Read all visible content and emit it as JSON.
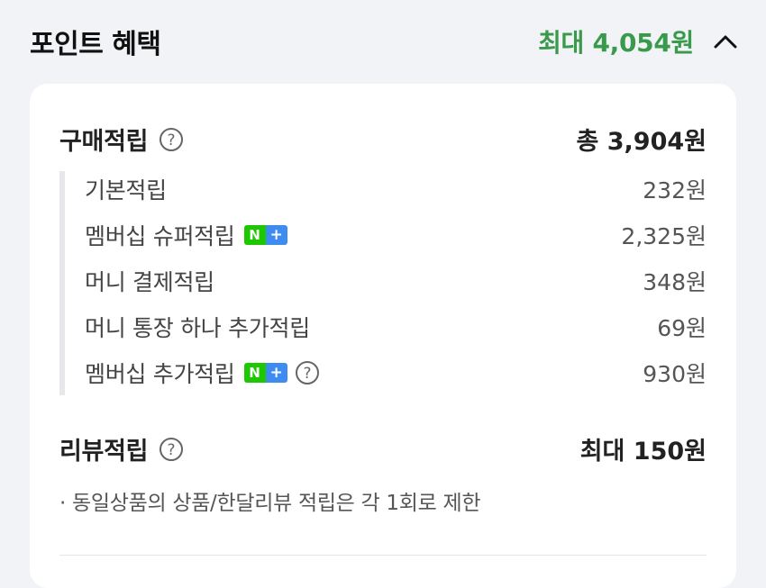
{
  "header": {
    "title": "포인트 혜택",
    "max_amount": "최대 4,054원",
    "chevron_icon": "chevron-up-icon",
    "accent_color": "#3a9a4b"
  },
  "purchase": {
    "title": "구매적립",
    "total": "총 3,904원",
    "help_icon": "question-circle-icon",
    "items": [
      {
        "label": "기본적립",
        "value": "232원",
        "badge": false,
        "help": false
      },
      {
        "label": "멤버십 슈퍼적립",
        "value": "2,325원",
        "badge": true,
        "help": false
      },
      {
        "label": "머니 결제적립",
        "value": "348원",
        "badge": false,
        "help": false
      },
      {
        "label": "머니 통장 하나 추가적립",
        "value": "69원",
        "badge": false,
        "help": false
      },
      {
        "label": "멤버십 추가적립",
        "value": "930원",
        "badge": true,
        "help": true
      }
    ],
    "badge": {
      "n": "N",
      "plus": "+",
      "n_color": "#1ec800",
      "plus_color": "#3e8cf0"
    }
  },
  "review": {
    "title": "리뷰적립",
    "value": "최대 150원",
    "help_icon": "question-circle-icon",
    "note": "· 동일상품의 상품/한달리뷰 적립은 각 1회로 제한"
  }
}
